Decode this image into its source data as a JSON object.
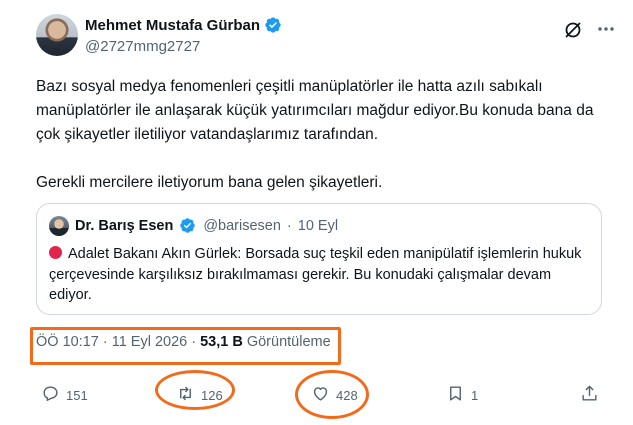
{
  "author": {
    "display_name": "Mehmet Mustafa Gürban",
    "handle": "@2727mmg2727",
    "verified": true
  },
  "tweet": {
    "paragraphs": [
      "Bazı sosyal medya fenomenleri çeşitli manüplatörler ile hatta azılı sabıkalı manüplatörler ile anlaşarak küçük yatırımcıları mağdur ediyor.Bu konuda bana da çok şikayetler iletiliyor vatandaşlarımız tarafından.",
      "Gerekli mercilere iletiyorum bana gelen şikayetleri."
    ]
  },
  "quote": {
    "display_name": "Dr. Barış Esen",
    "handle": "@barisesen",
    "separator": "·",
    "date": "10 Eyl",
    "text": "Adalet Bakanı Akın Gürlek: Borsada suç teşkil eden manipülatif işlemlerin hukuk çerçevesinde karşılıksız bırakılmaması gerekir. Bu konudaki çalışmalar devam ediyor."
  },
  "meta": {
    "time": "ÖÖ 10:17",
    "separator": "·",
    "date": "11 Eyl 2026",
    "views_count": "53,1 B",
    "views_label": "Görüntüleme"
  },
  "actions": {
    "replies": "151",
    "reposts": "126",
    "likes": "428",
    "bookmarks": "1"
  },
  "colors": {
    "verified_blue": "#1d9bf0",
    "highlight_orange": "#f26b1d",
    "secondary_text": "#536471"
  }
}
